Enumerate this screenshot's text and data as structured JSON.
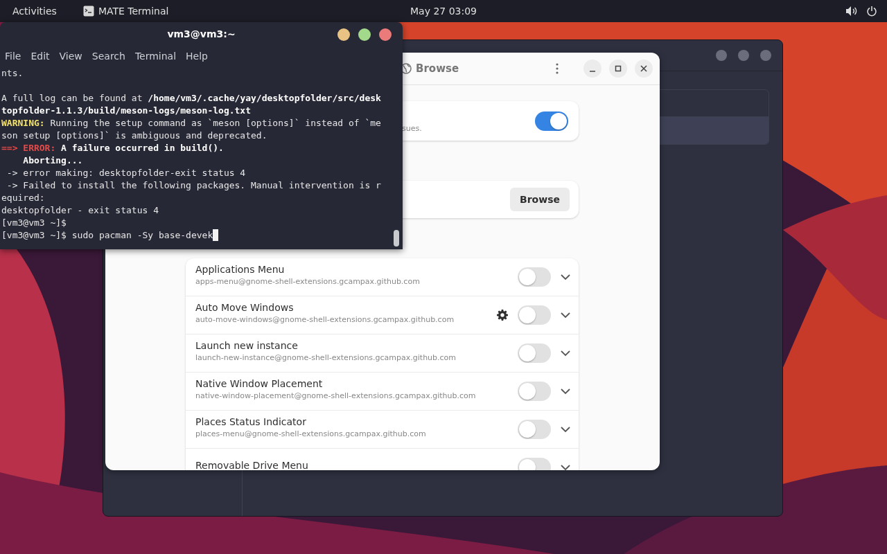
{
  "top_bar": {
    "activities": "Activities",
    "app": "MATE Terminal",
    "clock": "May 27  03:09"
  },
  "terminal": {
    "title": "vm3@vm3:~",
    "menu": [
      "File",
      "Edit",
      "View",
      "Search",
      "Terminal",
      "Help"
    ],
    "cursor_visible": true,
    "lines": [
      {
        "kind": "text",
        "segments": [
          {
            "kind": "plain",
            "text": "nts."
          }
        ]
      },
      {
        "kind": "blank"
      },
      {
        "kind": "text",
        "segments": [
          {
            "kind": "plain",
            "text": "A full log can be found at "
          },
          {
            "kind": "bold",
            "text": "/home/vm3/.cache/yay/desktopfolder/src/desk"
          }
        ]
      },
      {
        "kind": "text",
        "segments": [
          {
            "kind": "bold",
            "text": "topfolder-1.1.3/build/meson-logs/meson-log.txt"
          }
        ]
      },
      {
        "kind": "text",
        "segments": [
          {
            "kind": "warning",
            "text": "WARNING:"
          },
          {
            "kind": "plain",
            "text": " Running the setup command as `meson [options]` instead of `me"
          }
        ]
      },
      {
        "kind": "text",
        "segments": [
          {
            "kind": "plain",
            "text": "son setup [options]` is ambiguous and deprecated."
          }
        ]
      },
      {
        "kind": "text",
        "segments": [
          {
            "kind": "error",
            "text": "==> ERROR:"
          },
          {
            "kind": "bold",
            "text": " A failure occurred in build()."
          }
        ]
      },
      {
        "kind": "text",
        "segments": [
          {
            "kind": "bold",
            "text": "    Aborting..."
          }
        ]
      },
      {
        "kind": "text",
        "segments": [
          {
            "kind": "plain",
            "text": " -> error making: desktopfolder-exit status 4"
          }
        ]
      },
      {
        "kind": "text",
        "segments": [
          {
            "kind": "plain",
            "text": " -> Failed to install the following packages. Manual intervention is r"
          }
        ]
      },
      {
        "kind": "text",
        "segments": [
          {
            "kind": "plain",
            "text": "equired:"
          }
        ]
      },
      {
        "kind": "text",
        "segments": [
          {
            "kind": "plain",
            "text": "desktopfolder - exit status 4"
          }
        ]
      },
      {
        "kind": "text",
        "segments": [
          {
            "kind": "plain",
            "text": "[vm3@vm3 ~]$"
          }
        ]
      },
      {
        "kind": "text",
        "segments": [
          {
            "kind": "plain",
            "text": "[vm3@vm3 ~]$ sudo pacman -Sy base-devek"
          }
        ]
      }
    ]
  },
  "extensions_window": {
    "title": "Browse",
    "cards": [
      {
        "kind": "switch",
        "description": "sues.",
        "on": true
      },
      {
        "kind": "button",
        "button": "Browse"
      }
    ],
    "extensions": [
      {
        "name": "Applications Menu",
        "id": "apps-menu@gnome-shell-extensions.gcampax.github.com",
        "settings": false,
        "enabled": false
      },
      {
        "name": "Auto Move Windows",
        "id": "auto-move-windows@gnome-shell-extensions.gcampax.github.com",
        "settings": true,
        "enabled": false
      },
      {
        "name": "Launch new instance",
        "id": "launch-new-instance@gnome-shell-extensions.gcampax.github.com",
        "settings": false,
        "enabled": false
      },
      {
        "name": "Native Window Placement",
        "id": "native-window-placement@gnome-shell-extensions.gcampax.github.com",
        "settings": false,
        "enabled": false
      },
      {
        "name": "Places Status Indicator",
        "id": "places-menu@gnome-shell-extensions.gcampax.github.com",
        "settings": false,
        "enabled": false
      },
      {
        "name": "Removable Drive Menu",
        "settings": false,
        "enabled": false
      }
    ]
  }
}
